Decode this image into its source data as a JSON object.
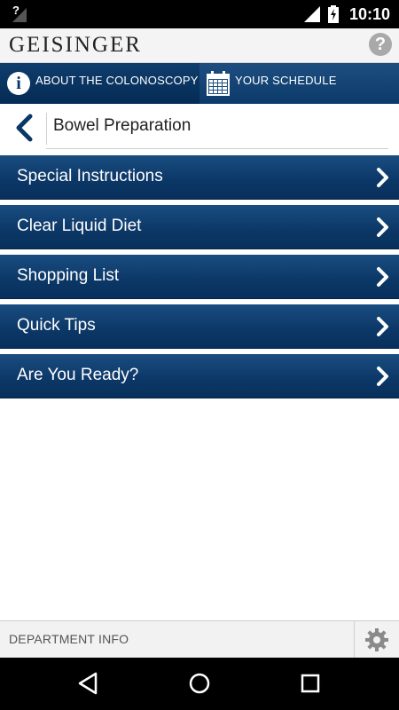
{
  "status_bar": {
    "left_indicator": "?",
    "time": "10:10"
  },
  "header": {
    "logo": "GEISINGER",
    "help_label": "?"
  },
  "tabs": [
    {
      "label": "ABOUT THE COLONOSCOPY",
      "icon": "info-icon"
    },
    {
      "label": "YOUR SCHEDULE",
      "icon": "calendar-icon"
    }
  ],
  "page": {
    "title": "Bowel Preparation"
  },
  "menu": [
    {
      "label": "Special Instructions"
    },
    {
      "label": "Clear Liquid Diet"
    },
    {
      "label": "Shopping List"
    },
    {
      "label": "Quick Tips"
    },
    {
      "label": "Are You Ready?"
    }
  ],
  "bottom_bar": {
    "department_label": "DEPARTMENT INFO"
  },
  "colors": {
    "brand_blue": "#0b3766",
    "header_bg": "#f4f4f4"
  }
}
